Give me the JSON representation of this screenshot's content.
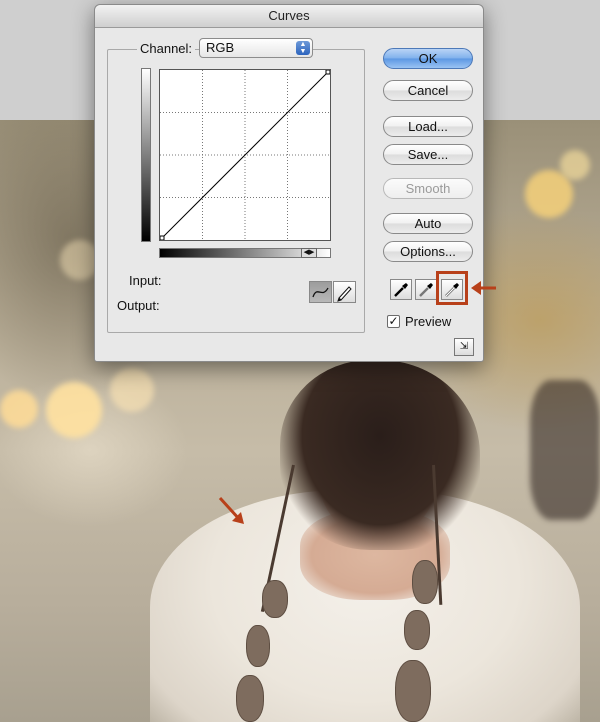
{
  "dialog": {
    "title": "Curves",
    "channel_label": "Channel:",
    "channel_value": "RGB",
    "input_label": "Input:",
    "output_label": "Output:",
    "buttons": {
      "ok": "OK",
      "cancel": "Cancel",
      "load": "Load...",
      "save": "Save...",
      "smooth": "Smooth",
      "auto": "Auto",
      "options": "Options..."
    },
    "preview_label": "Preview",
    "preview_checked": true
  },
  "icons": {
    "curve_tool": "curve-icon",
    "pencil_tool": "pencil-icon",
    "black_eyedropper": "black-eyedropper-icon",
    "gray_eyedropper": "gray-eyedropper-icon",
    "white_eyedropper": "white-eyedropper-icon",
    "expand": "expand-icon"
  },
  "colors": {
    "highlight": "#b8401a",
    "default_button": "#5c97e3"
  }
}
